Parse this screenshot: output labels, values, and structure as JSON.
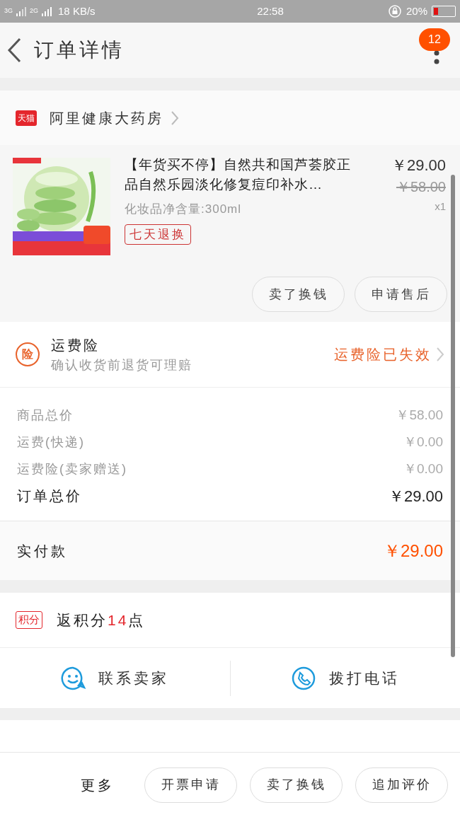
{
  "status_bar": {
    "network_1": "3G",
    "network_2": "2G",
    "speed": "18 KB/s",
    "time": "22:58",
    "battery": "20%"
  },
  "header": {
    "title": "订单详情",
    "badge": "12"
  },
  "shop": {
    "tag": "天猫",
    "name": "阿里健康大药房"
  },
  "product": {
    "title": "【年货买不停】自然共和国芦荟胶正品自然乐园淡化修复痘印补水…",
    "spec": "化妆品净含量:300ml",
    "tag": "七天退换",
    "price": "￥29.00",
    "original_price": "￥58.00",
    "quantity": "x1",
    "buttons": [
      "卖了换钱",
      "申请售后"
    ]
  },
  "insurance": {
    "icon_text": "险",
    "title": "运费险",
    "subtitle": "确认收货前退货可理赔",
    "status": "运费险已失效"
  },
  "fees": [
    {
      "label": "商品总价",
      "value": "￥58.00",
      "kind": "minor"
    },
    {
      "label": "运费(快递)",
      "value": "￥0.00",
      "kind": "minor"
    },
    {
      "label": "运费险(卖家赠送)",
      "value": "￥0.00",
      "kind": "minor"
    },
    {
      "label": "订单总价",
      "value": "￥29.00",
      "kind": "total"
    }
  ],
  "payment": {
    "label": "实付款",
    "value": "￥29.00"
  },
  "points": {
    "tag": "积分",
    "text": "返积分**14**点"
  },
  "contact": [
    "联系卖家",
    "拨打电话"
  ],
  "bottom_bar": {
    "more": "更多",
    "buttons": [
      "开票申请",
      "卖了换钱",
      "追加评价"
    ]
  }
}
